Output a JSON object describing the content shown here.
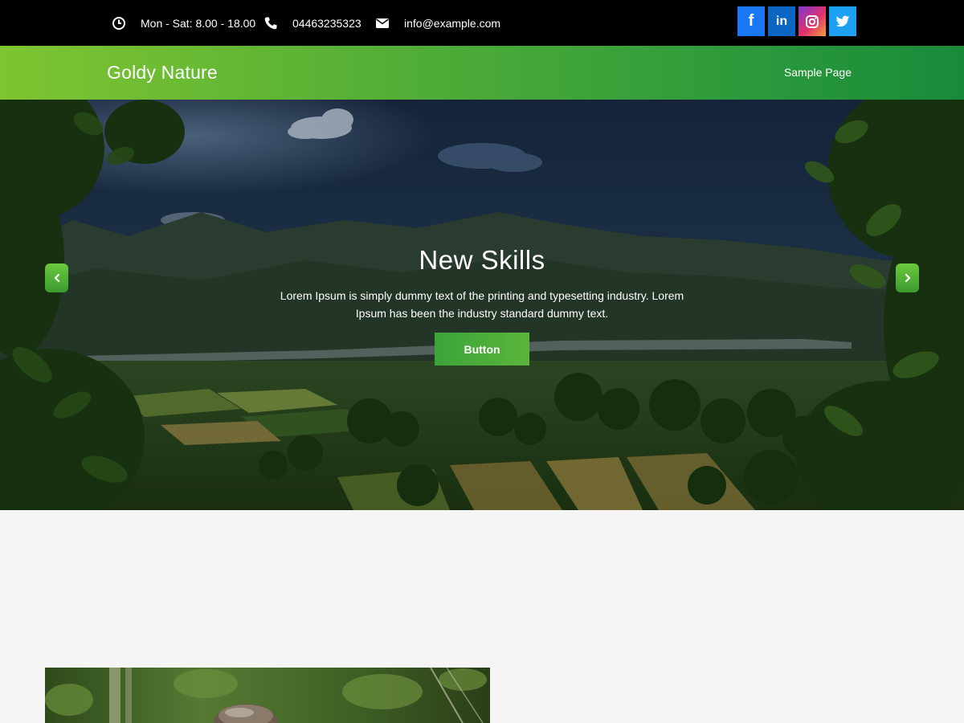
{
  "topbar": {
    "hours": {
      "icon": "clock-icon",
      "text": "Mon - Sat: 8.00 - 18.00"
    },
    "phone": {
      "icon": "phone-icon",
      "text": "04463235323"
    },
    "email": {
      "icon": "envelope-icon",
      "text": "info@example.com"
    },
    "social": [
      {
        "name": "facebook",
        "icon": "facebook-icon",
        "glyph": "f",
        "color": "#1877f2"
      },
      {
        "name": "linkedin",
        "icon": "linkedin-icon",
        "glyph": "in",
        "color": "#0a66c2"
      },
      {
        "name": "instagram",
        "icon": "instagram-icon",
        "glyph": "",
        "color": "#e1306c"
      },
      {
        "name": "twitter",
        "icon": "twitter-icon",
        "glyph": "",
        "color": "#1da1f2"
      }
    ]
  },
  "header": {
    "brand": "Goldy Nature",
    "nav": [
      {
        "label": "Sample Page"
      }
    ],
    "gradient": [
      "#7fc531",
      "#188a3a"
    ]
  },
  "hero": {
    "title": "New Skills",
    "text": "Lorem Ipsum is simply dummy text of the printing and typesetting industry. Lorem Ipsum has been the industry standard dummy text.",
    "button_label": "Button",
    "prev_icon": "chevron-left-icon",
    "next_icon": "chevron-right-icon"
  },
  "colors": {
    "topbar_bg": "#000000",
    "accent_green": "#3aa43a",
    "page_bg": "#f5f5f5"
  }
}
